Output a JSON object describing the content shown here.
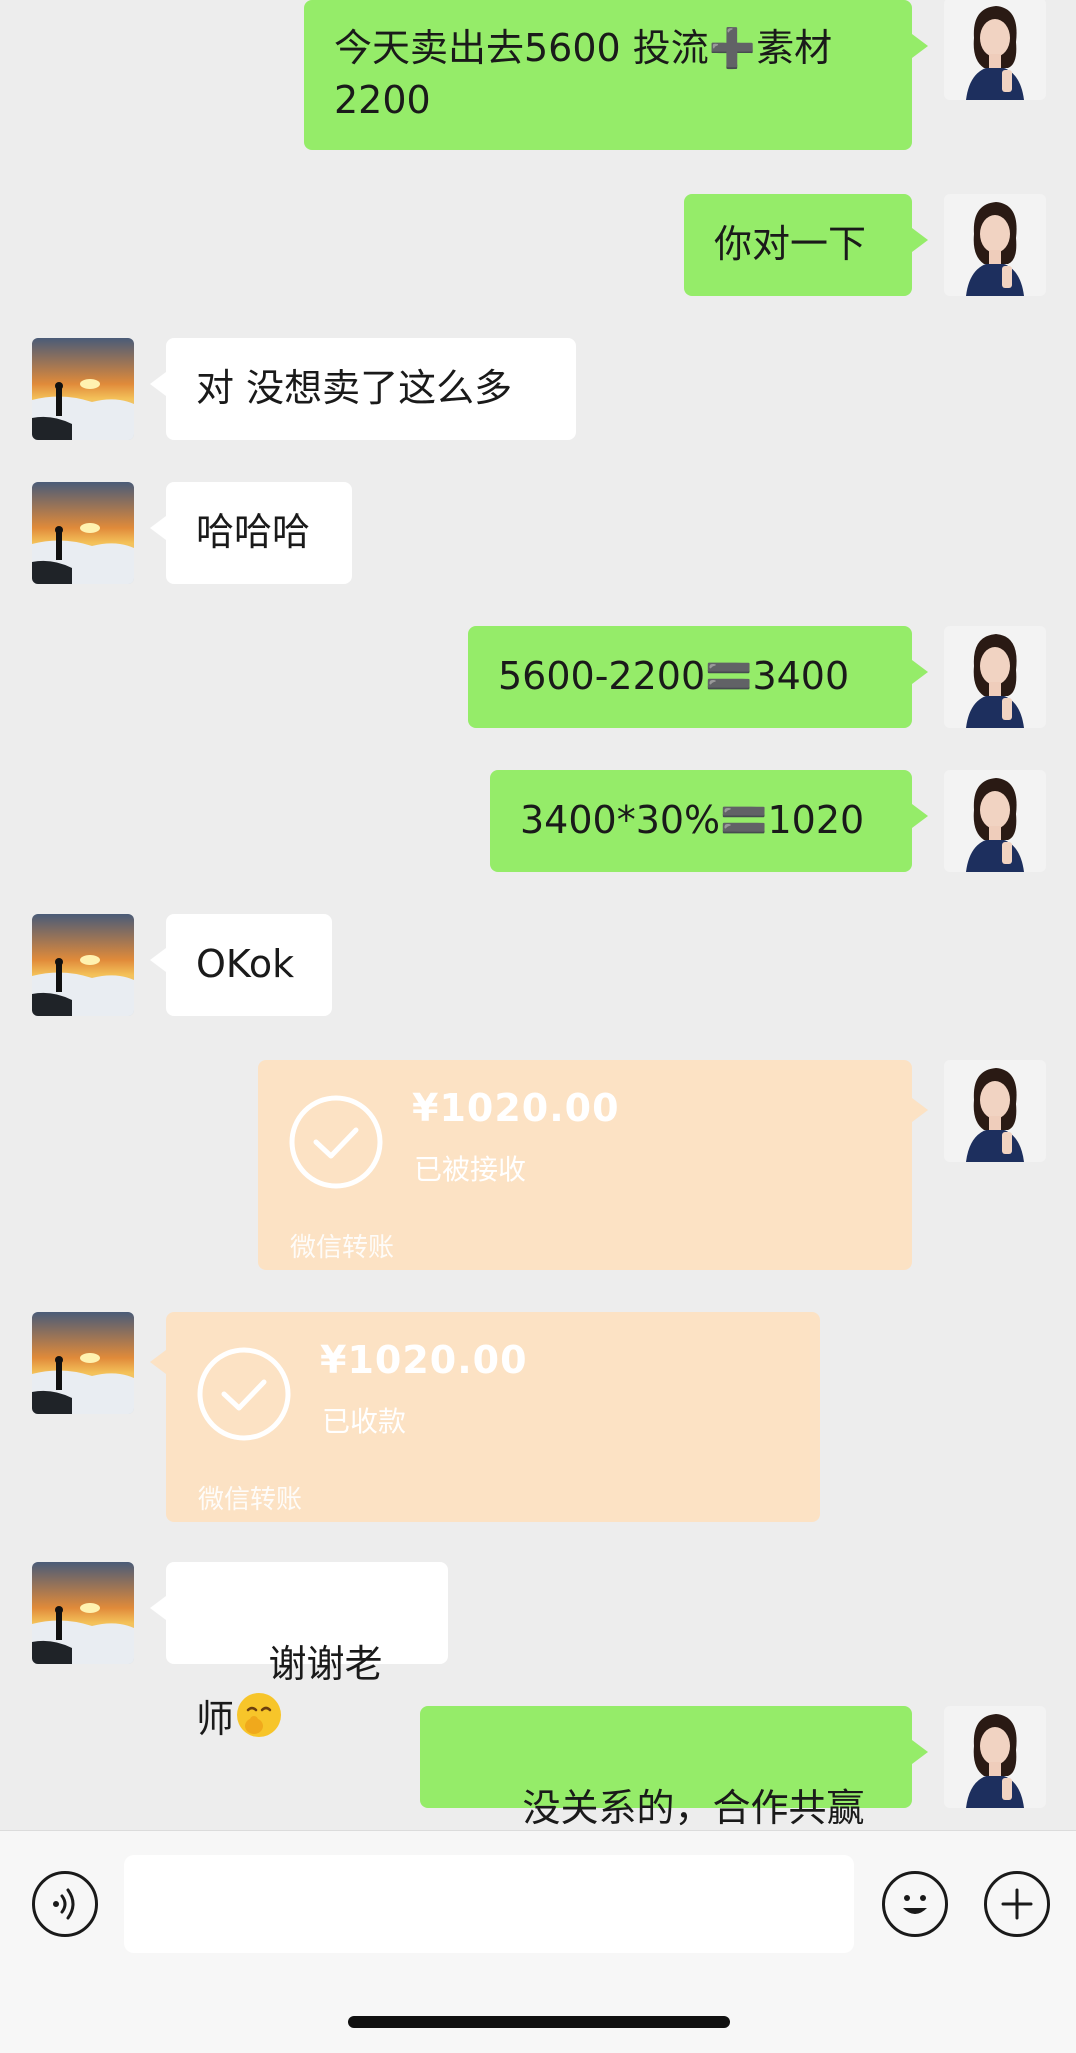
{
  "colors": {
    "background": "#ededed",
    "outgoing_bubble": "#95ec69",
    "incoming_bubble": "#ffffff",
    "transfer_card": "#fce2c4"
  },
  "messages": [
    {
      "side": "right",
      "text": "今天卖出去5600 投流➕素材\n2200"
    },
    {
      "side": "right",
      "text": "你对一下"
    },
    {
      "side": "left",
      "text": "对 没想卖了这么多"
    },
    {
      "side": "left",
      "text": "哈哈哈"
    },
    {
      "side": "right",
      "text": "5600-2200🟰3400"
    },
    {
      "side": "right",
      "text": "3400*30%🟰1020"
    },
    {
      "side": "left",
      "text": "OKok"
    },
    {
      "side": "right",
      "type": "transfer",
      "amount": "¥1020.00",
      "status": "已被接收",
      "footer": "微信转账"
    },
    {
      "side": "left",
      "type": "transfer",
      "amount": "¥1020.00",
      "status": "已收款",
      "footer": "微信转账"
    },
    {
      "side": "left",
      "text": "谢谢老师",
      "emoji": "shush-face-emoji"
    },
    {
      "side": "right",
      "text": "没关系的，合作共赢",
      "emoji": "raised-fist-emoji"
    }
  ],
  "input_bar": {
    "voice_icon": "voice-icon",
    "emoji_icon": "emoji-icon",
    "plus_icon": "plus-icon",
    "input_value": ""
  }
}
